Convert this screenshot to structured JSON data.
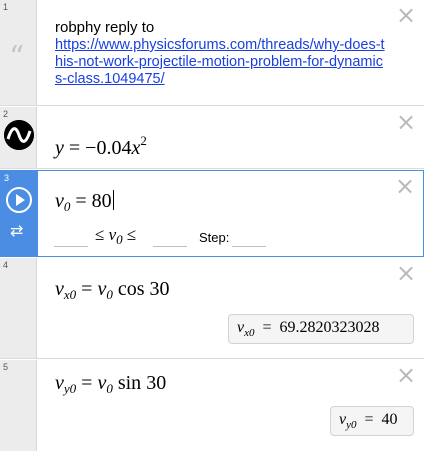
{
  "expressions": [
    {
      "index": "1",
      "type": "note",
      "author": "robphy reply to",
      "link": "https://www.physicsforums.com/threads/why-does-this-not-work-projectile-motion-problem-for-dynamics-class.1049475/"
    },
    {
      "index": "2",
      "lhs": "y",
      "eq": "=",
      "rhs": "−0.04",
      "var": "x",
      "exp": "2"
    },
    {
      "index": "3",
      "var": "v",
      "sub": "0",
      "eq": "=",
      "value": "80",
      "slider": {
        "leq": "≤",
        "step_label": "Step:"
      }
    },
    {
      "index": "4",
      "lhs_var": "v",
      "lhs_sub": "x0",
      "eq": "=",
      "rhs_var": "v",
      "rhs_sub": "0",
      "func": "cos",
      "arg": "30",
      "result": {
        "var": "v",
        "sub": "x0",
        "eq": "=",
        "value": "69.2820323028"
      }
    },
    {
      "index": "5",
      "lhs_var": "v",
      "lhs_sub": "y0",
      "eq": "=",
      "rhs_var": "v",
      "rhs_sub": "0",
      "func": "sin",
      "arg": "30",
      "result": {
        "var": "v",
        "sub": "y0",
        "eq": "=",
        "value": "40"
      }
    }
  ],
  "icons": {
    "close": "×",
    "quote": "“",
    "loop": "⇄"
  },
  "colors": {
    "active": "#4a8de3",
    "link": "#1a3fe0",
    "gutter": "#ececec"
  }
}
